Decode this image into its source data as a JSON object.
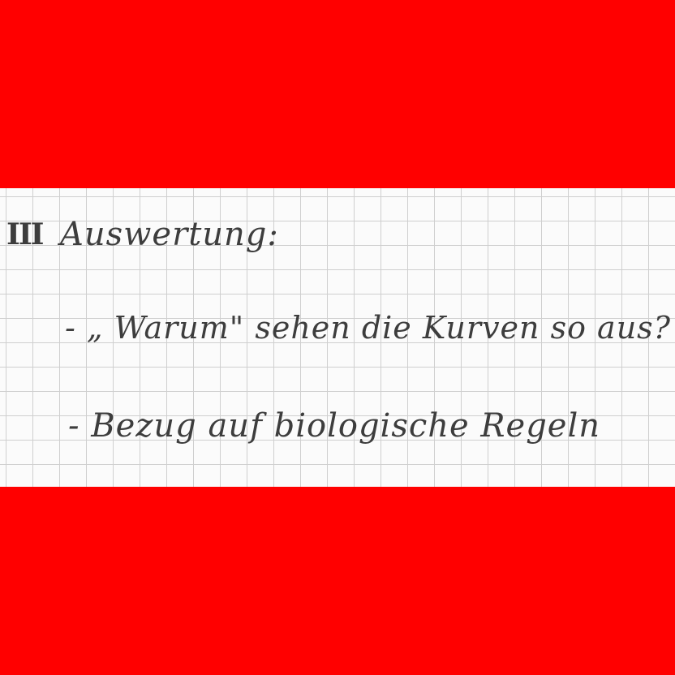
{
  "note": {
    "section_number": "III",
    "heading": "Auswertung:",
    "bullets": [
      "- „ Warum\" sehen die Kurven so aus?",
      "- Bezug auf biologische Regeln"
    ]
  },
  "colors": {
    "background_band": "#ff0000",
    "paper": "#fbfbfb",
    "grid_line": "#cfcfcf",
    "ink": "#3d3d3d"
  }
}
